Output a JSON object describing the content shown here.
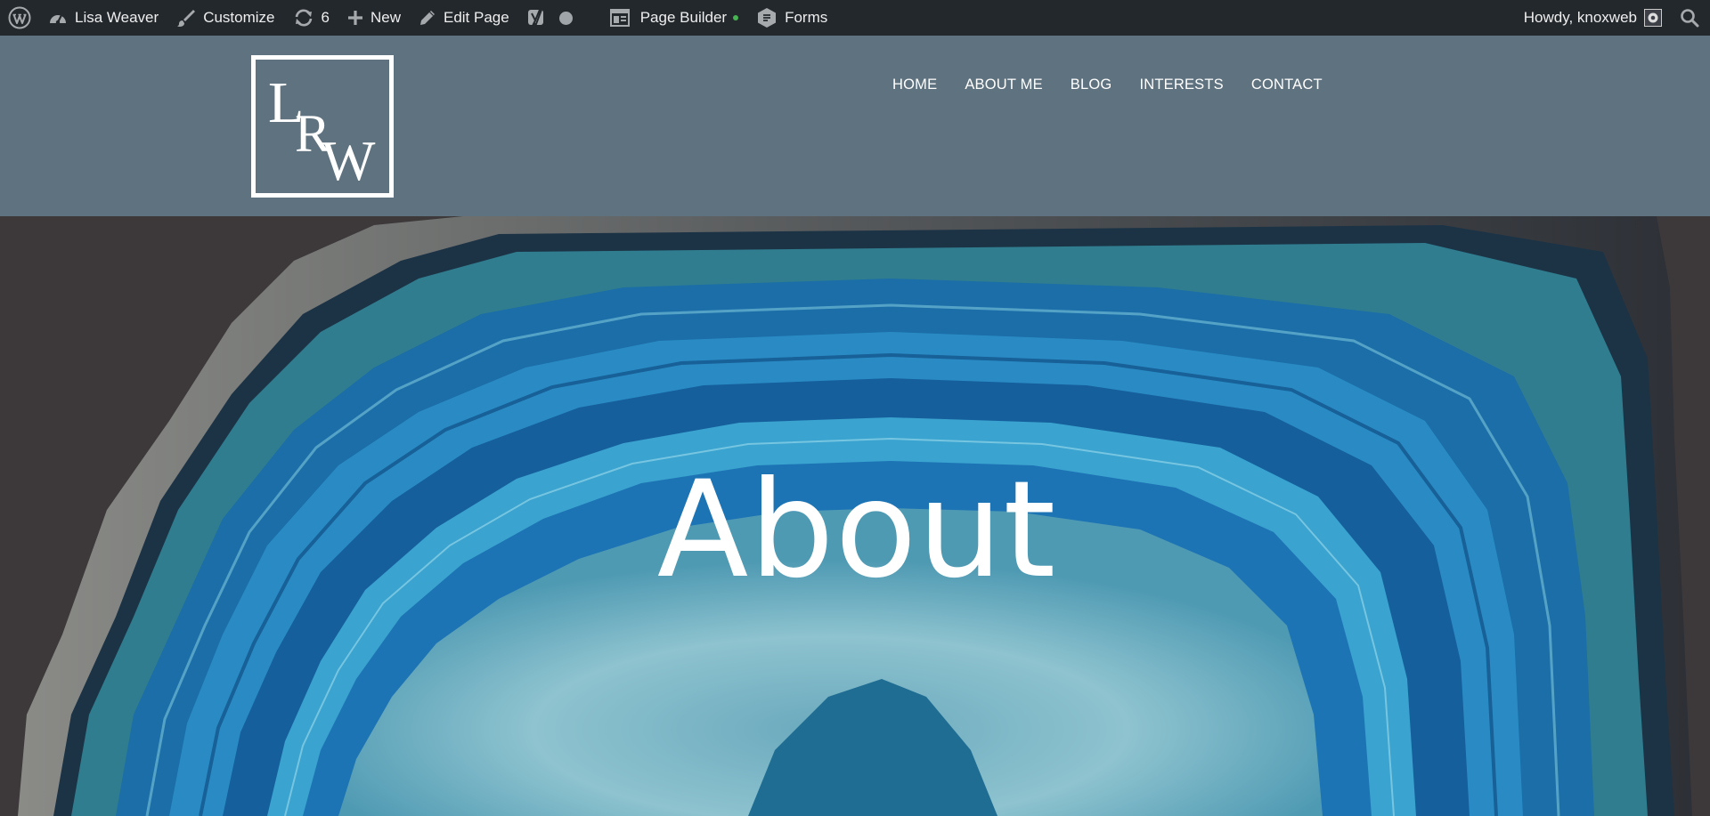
{
  "admin_bar": {
    "site_name": "Lisa Weaver",
    "customize_label": "Customize",
    "updates_count": "6",
    "new_label": "New",
    "edit_page_label": "Edit Page",
    "page_builder_label": "Page Builder",
    "forms_label": "Forms",
    "greeting": "Howdy, knoxweb",
    "status_dot_color": "#46b450"
  },
  "header": {
    "logo_letters": [
      "L",
      "R",
      "W"
    ],
    "nav": [
      {
        "label": "HOME"
      },
      {
        "label": "ABOUT ME"
      },
      {
        "label": "BLOG"
      },
      {
        "label": "INTERESTS"
      },
      {
        "label": "CONTACT"
      }
    ]
  },
  "hero": {
    "title": "About"
  },
  "colors": {
    "admin_bar_bg": "#23282d",
    "header_bg": "#5f727f",
    "page_bg": "#3d393a",
    "agate_blue": "#1e7bb5",
    "agate_teal": "#3fa2c0"
  }
}
